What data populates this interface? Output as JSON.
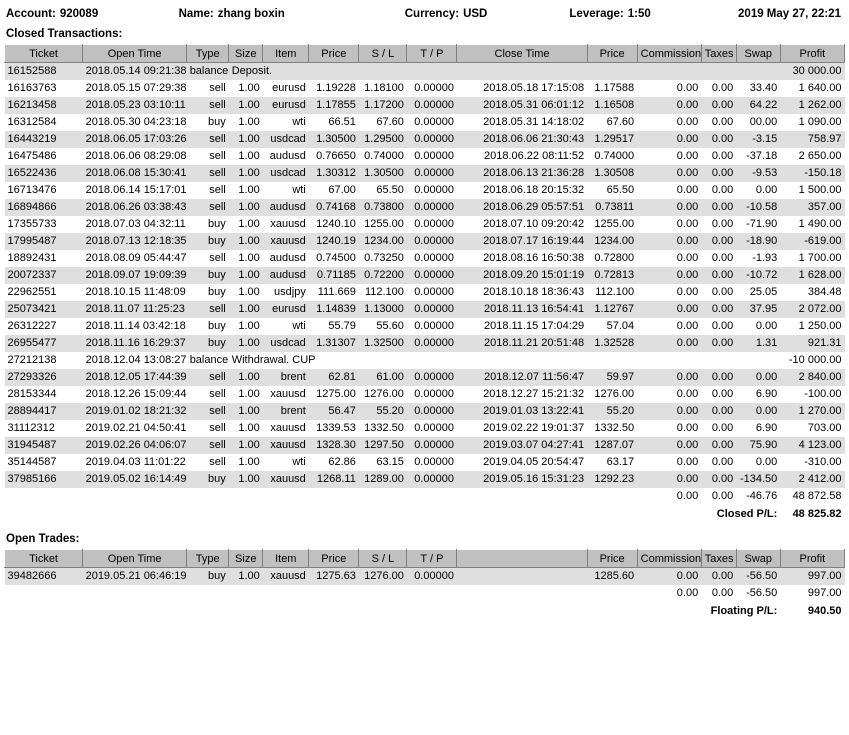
{
  "header": {
    "account_label": "Account:",
    "account_value": "920089",
    "name_label": "Name:",
    "name_value": "zhang boxin",
    "currency_label": "Currency:",
    "currency_value": "USD",
    "leverage_label": "Leverage:",
    "leverage_value": "1:50",
    "date": "2019 May 27, 22:21"
  },
  "closed": {
    "title": "Closed Transactions:",
    "columns": {
      "ticket": "Ticket",
      "open_time": "Open Time",
      "type": "Type",
      "size": "Size",
      "item": "Item",
      "price": "Price",
      "sl": "S / L",
      "tp": "T / P",
      "close_time": "Close Time",
      "price2": "Price",
      "commission": "Commission",
      "taxes": "Taxes",
      "swap": "Swap",
      "profit": "Profit"
    },
    "rows": [
      {
        "ticket": "16152588",
        "open_time": "2018.05.14 09:21:38",
        "type": "balance",
        "balance": true,
        "desc": "Deposit.",
        "profit": "30 000.00"
      },
      {
        "ticket": "16163763",
        "open_time": "2018.05.15 07:29:38",
        "type": "sell",
        "size": "1.00",
        "item": "eurusd",
        "price": "1.19228",
        "sl": "1.18100",
        "tp": "0.00000",
        "close_time": "2018.05.18 17:15:08",
        "price2": "1.17588",
        "commission": "0.00",
        "taxes": "0.00",
        "swap": "33.40",
        "profit": "1 640.00"
      },
      {
        "ticket": "16213458",
        "open_time": "2018.05.23 03:10:11",
        "type": "sell",
        "size": "1.00",
        "item": "eurusd",
        "price": "1.17855",
        "sl": "1.17200",
        "tp": "0.00000",
        "close_time": "2018.05.31 06:01:12",
        "price2": "1.16508",
        "commission": "0.00",
        "taxes": "0.00",
        "swap": "64.22",
        "profit": "1 262.00"
      },
      {
        "ticket": "16312584",
        "open_time": "2018.05.30 04:23:18",
        "type": "buy",
        "size": "1.00",
        "item": "wti",
        "price": "66.51",
        "sl": "67.60",
        "tp": "0.00000",
        "close_time": "2018.05.31 14:18:02",
        "price2": "67.60",
        "commission": "0.00",
        "taxes": "0.00",
        "swap": "00.00",
        "profit": "1 090.00"
      },
      {
        "ticket": "16443219",
        "open_time": "2018.06.05 17:03:26",
        "type": "sell",
        "size": "1.00",
        "item": "usdcad",
        "price": "1.30500",
        "sl": "1.29500",
        "tp": "0.00000",
        "close_time": "2018.06.06 21:30:43",
        "price2": "1.29517",
        "commission": "0.00",
        "taxes": "0.00",
        "swap": "-3.15",
        "profit": "758.97"
      },
      {
        "ticket": "16475486",
        "open_time": "2018.06.06 08:29:08",
        "type": "sell",
        "size": "1.00",
        "item": "audusd",
        "price": "0.76650",
        "sl": "0.74000",
        "tp": "0.00000",
        "close_time": "2018.06.22 08:11:52",
        "price2": "0.74000",
        "commission": "0.00",
        "taxes": "0.00",
        "swap": "-37.18",
        "profit": "2 650.00"
      },
      {
        "ticket": "16522436",
        "open_time": "2018.06.08 15:30:41",
        "type": "sell",
        "size": "1.00",
        "item": "usdcad",
        "price": "1.30312",
        "sl": "1.30500",
        "tp": "0.00000",
        "close_time": "2018.06.13 21:36:28",
        "price2": "1.30508",
        "commission": "0.00",
        "taxes": "0.00",
        "swap": "-9.53",
        "profit": "-150.18"
      },
      {
        "ticket": "16713476",
        "open_time": "2018.06.14 15:17:01",
        "type": "sell",
        "size": "1.00",
        "item": "wti",
        "price": "67.00",
        "sl": "65.50",
        "tp": "0.00000",
        "close_time": "2018.06.18 20:15:32",
        "price2": "65.50",
        "commission": "0.00",
        "taxes": "0.00",
        "swap": "0.00",
        "profit": "1 500.00"
      },
      {
        "ticket": "16894866",
        "open_time": "2018.06.26 03:38:43",
        "type": "sell",
        "size": "1.00",
        "item": "audusd",
        "price": "0.74168",
        "sl": "0.73800",
        "tp": "0.00000",
        "close_time": "2018.06.29 05:57:51",
        "price2": "0.73811",
        "commission": "0.00",
        "taxes": "0.00",
        "swap": "-10.58",
        "profit": "357.00"
      },
      {
        "ticket": "17355733",
        "open_time": "2018.07.03 04:32:11",
        "type": "buy",
        "size": "1.00",
        "item": "xauusd",
        "price": "1240.10",
        "sl": "1255.00",
        "tp": "0.00000",
        "close_time": "2018.07.10 09:20:42",
        "price2": "1255.00",
        "commission": "0.00",
        "taxes": "0.00",
        "swap": "-71.90",
        "profit": "1 490.00"
      },
      {
        "ticket": "17995487",
        "open_time": "2018.07.13 12:18:35",
        "type": "buy",
        "size": "1.00",
        "item": "xauusd",
        "price": "1240.19",
        "sl": "1234.00",
        "tp": "0.00000",
        "close_time": "2018.07.17 16:19:44",
        "price2": "1234.00",
        "commission": "0.00",
        "taxes": "0.00",
        "swap": "-18.90",
        "profit": "-619.00"
      },
      {
        "ticket": "18892431",
        "open_time": "2018.08.09 05:44:47",
        "type": "sell",
        "size": "1.00",
        "item": "audusd",
        "price": "0.74500",
        "sl": "0.73250",
        "tp": "0.00000",
        "close_time": "2018.08.16 16:50:38",
        "price2": "0.72800",
        "commission": "0.00",
        "taxes": "0.00",
        "swap": "-1.93",
        "profit": "1 700.00"
      },
      {
        "ticket": "20072337",
        "open_time": "2018.09.07 19:09:39",
        "type": "buy",
        "size": "1.00",
        "item": "audusd",
        "price": "0.71185",
        "sl": "0.72200",
        "tp": "0.00000",
        "close_time": "2018.09.20 15:01:19",
        "price2": "0.72813",
        "commission": "0.00",
        "taxes": "0.00",
        "swap": "-10.72",
        "profit": "1 628.00"
      },
      {
        "ticket": "22962551",
        "open_time": "2018.10.15 11:48:09",
        "type": "buy",
        "size": "1.00",
        "item": "usdjpy",
        "price": "111.669",
        "sl": "112.100",
        "tp": "0.00000",
        "close_time": "2018.10.18 18:36:43",
        "price2": "112.100",
        "commission": "0.00",
        "taxes": "0.00",
        "swap": "25.05",
        "profit": "384.48"
      },
      {
        "ticket": "25073421",
        "open_time": "2018.11.07 11:25:23",
        "type": "sell",
        "size": "1.00",
        "item": "eurusd",
        "price": "1.14839",
        "sl": "1.13000",
        "tp": "0.00000",
        "close_time": "2018.11.13 16:54:41",
        "price2": "1.12767",
        "commission": "0.00",
        "taxes": "0.00",
        "swap": "37.95",
        "profit": "2 072.00"
      },
      {
        "ticket": "26312227",
        "open_time": "2018.11.14 03:42:18",
        "type": "buy",
        "size": "1.00",
        "item": "wti",
        "price": "55.79",
        "sl": "55.60",
        "tp": "0.00000",
        "close_time": "2018.11.15 17:04:29",
        "price2": "57.04",
        "commission": "0.00",
        "taxes": "0.00",
        "swap": "0.00",
        "profit": "1 250.00"
      },
      {
        "ticket": "26955477",
        "open_time": "2018.11.16 16:29:37",
        "type": "buy",
        "size": "1.00",
        "item": "usdcad",
        "price": "1.31307",
        "sl": "1.32500",
        "tp": "0.00000",
        "close_time": "2018.11.21 20:51:48",
        "price2": "1.32528",
        "commission": "0.00",
        "taxes": "0.00",
        "swap": "1.31",
        "profit": "921.31"
      },
      {
        "ticket": "27212138",
        "open_time": "2018.12.04 13:08:27",
        "type": "balance",
        "balance": true,
        "desc": "Withdrawal. CUP",
        "profit": "-10 000.00"
      },
      {
        "ticket": "27293326",
        "open_time": "2018.12.05 17:44:39",
        "type": "sell",
        "size": "1.00",
        "item": "brent",
        "price": "62.81",
        "sl": "61.00",
        "tp": "0.00000",
        "close_time": "2018.12.07 11:56:47",
        "price2": "59.97",
        "commission": "0.00",
        "taxes": "0.00",
        "swap": "0.00",
        "profit": "2 840.00"
      },
      {
        "ticket": "28153344",
        "open_time": "2018.12.26 15:09:44",
        "type": "sell",
        "size": "1.00",
        "item": "xauusd",
        "price": "1275.00",
        "sl": "1276.00",
        "tp": "0.00000",
        "close_time": "2018.12.27 15:21:32",
        "price2": "1276.00",
        "commission": "0.00",
        "taxes": "0.00",
        "swap": "6.90",
        "profit": "-100.00"
      },
      {
        "ticket": "28894417",
        "open_time": "2019.01.02 18:21:32",
        "type": "sell",
        "size": "1.00",
        "item": "brent",
        "price": "56.47",
        "sl": "55.20",
        "tp": "0.00000",
        "close_time": "2019.01.03 13:22:41",
        "price2": "55.20",
        "commission": "0.00",
        "taxes": "0.00",
        "swap": "0.00",
        "profit": "1 270.00"
      },
      {
        "ticket": "31112312",
        "open_time": "2019.02.21 04:50:41",
        "type": "sell",
        "size": "1.00",
        "item": "xauusd",
        "price": "1339.53",
        "sl": "1332.50",
        "tp": "0.00000",
        "close_time": "2019.02.22 19:01:37",
        "price2": "1332.50",
        "commission": "0.00",
        "taxes": "0.00",
        "swap": "6.90",
        "profit": "703.00"
      },
      {
        "ticket": "31945487",
        "open_time": "2019.02.26 04:06:07",
        "type": "sell",
        "size": "1.00",
        "item": "xauusd",
        "price": "1328.30",
        "sl": "1297.50",
        "tp": "0.00000",
        "close_time": "2019.03.07 04:27:41",
        "price2": "1287.07",
        "commission": "0.00",
        "taxes": "0.00",
        "swap": "75.90",
        "profit": "4 123.00"
      },
      {
        "ticket": "35144587",
        "open_time": "2019.04.03 11:01:22",
        "type": "sell",
        "size": "1.00",
        "item": "wti",
        "price": "62.86",
        "sl": "63.15",
        "tp": "0.00000",
        "close_time": "2019.04.05 20:54:47",
        "price2": "63.17",
        "commission": "0.00",
        "taxes": "0.00",
        "swap": "0.00",
        "profit": "-310.00"
      },
      {
        "ticket": "37985166",
        "open_time": "2019.05.02 16:14:49",
        "type": "buy",
        "size": "1.00",
        "item": "xauusd",
        "price": "1268.11",
        "sl": "1289.00",
        "tp": "0.00000",
        "close_time": "2019.05.16 15:31:23",
        "price2": "1292.23",
        "commission": "0.00",
        "taxes": "0.00",
        "swap": "-134.50",
        "profit": "2 412.00"
      }
    ],
    "subtotal": {
      "commission": "0.00",
      "taxes": "0.00",
      "swap": "-46.76",
      "profit": "48 872.58"
    },
    "total": {
      "label": "Closed P/L:",
      "value": "48 825.82"
    }
  },
  "open": {
    "title": "Open Trades:",
    "columns": {
      "ticket": "Ticket",
      "open_time": "Open Time",
      "type": "Type",
      "size": "Size",
      "item": "Item",
      "price": "Price",
      "sl": "S / L",
      "tp": "T / P",
      "blank": "",
      "price2": "Price",
      "commission": "Commission",
      "taxes": "Taxes",
      "swap": "Swap",
      "profit": "Profit"
    },
    "rows": [
      {
        "ticket": "39482666",
        "open_time": "2019.05.21 06:46:19",
        "type": "buy",
        "size": "1.00",
        "item": "xauusd",
        "price": "1275.63",
        "sl": "1276.00",
        "tp": "0.00000",
        "price2": "1285.60",
        "commission": "0.00",
        "taxes": "0.00",
        "swap": "-56.50",
        "profit": "997.00"
      }
    ],
    "subtotal": {
      "commission": "0.00",
      "taxes": "0.00",
      "swap": "-56.50",
      "profit": "997.00"
    },
    "total": {
      "label": "Floating P/L:",
      "value": "940.50"
    }
  }
}
